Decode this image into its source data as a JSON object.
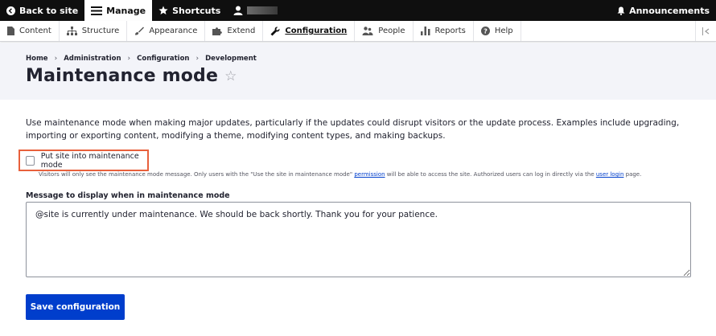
{
  "toolbar": {
    "back_label": "Back to site",
    "manage_label": "Manage",
    "shortcuts_label": "Shortcuts",
    "announcements_label": "Announcements"
  },
  "tray": {
    "items": [
      {
        "label": "Content",
        "icon": "file-icon"
      },
      {
        "label": "Structure",
        "icon": "sitemap-icon"
      },
      {
        "label": "Appearance",
        "icon": "paintbrush-icon"
      },
      {
        "label": "Extend",
        "icon": "puzzle-icon"
      },
      {
        "label": "Configuration",
        "icon": "wrench-icon",
        "active": true
      },
      {
        "label": "People",
        "icon": "people-icon"
      },
      {
        "label": "Reports",
        "icon": "chart-icon"
      },
      {
        "label": "Help",
        "icon": "help-icon"
      }
    ]
  },
  "breadcrumb": [
    "Home",
    "Administration",
    "Configuration",
    "Development"
  ],
  "page": {
    "title": "Maintenance mode",
    "description": "Use maintenance mode when making major updates, particularly if the updates could disrupt visitors or the update process. Examples include upgrading, importing or exporting content, modifying a theme, modifying content types, and making backups."
  },
  "form": {
    "checkbox_label": "Put site into maintenance mode",
    "help_before": "Visitors will only see the maintenance mode message. Only users with the \"Use the site in maintenance mode\" ",
    "help_link1": "permission",
    "help_middle": " will be able to access the site. Authorized users can log in directly via the ",
    "help_link2": "user login",
    "help_after": " page.",
    "message_label": "Message to display when in maintenance mode",
    "message_value": "@site is currently under maintenance. We should be back shortly. Thank you for your patience.",
    "save_label": "Save configuration"
  },
  "colors": {
    "toolbar_bg": "#0f0f0f",
    "accent_blue": "#003ecc",
    "highlight_orange": "#e8603c",
    "header_bg": "#f3f4f9"
  }
}
